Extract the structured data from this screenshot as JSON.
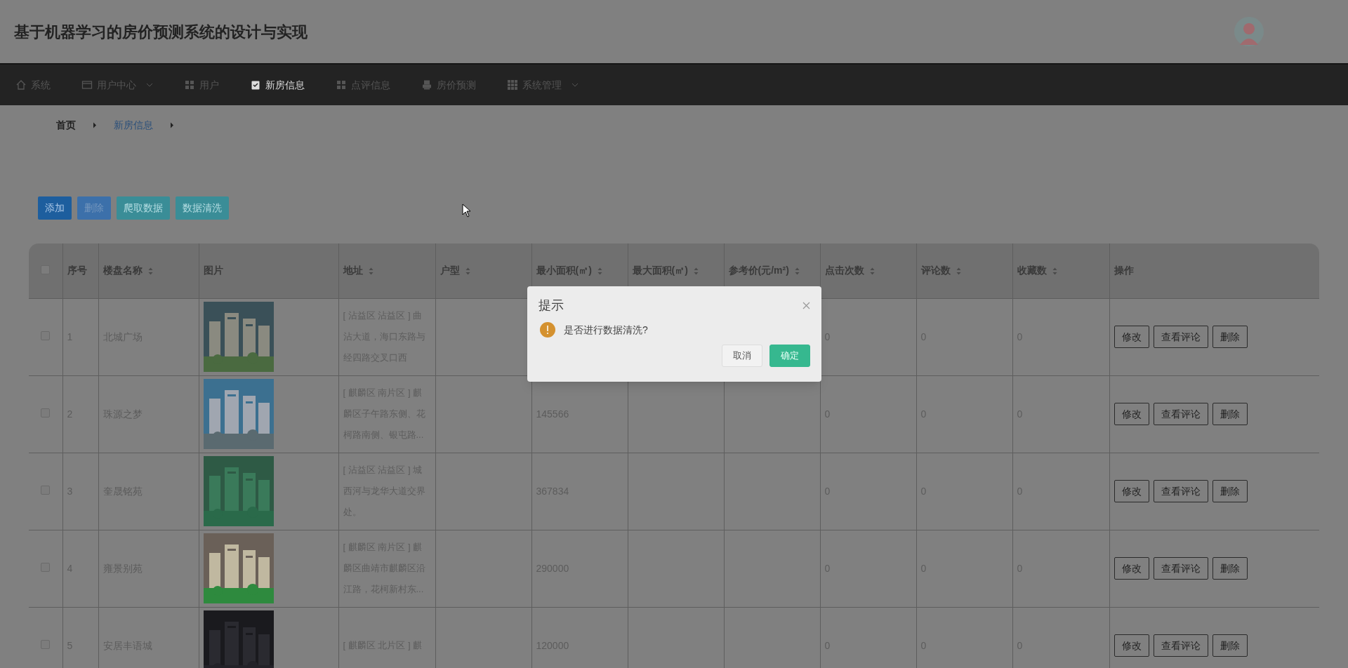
{
  "header": {
    "title": "基于机器学习的房价预测系统的设计与实现"
  },
  "nav": [
    {
      "label": "系统",
      "kind": "house",
      "menu": false,
      "selected": false
    },
    {
      "label": "用户中心",
      "kind": "card",
      "menu": true,
      "selected": false
    },
    {
      "label": "用户",
      "kind": "grid",
      "menu": false,
      "selected": false
    },
    {
      "label": "新房信息",
      "kind": "clipboard",
      "menu": false,
      "selected": true
    },
    {
      "label": "点评信息",
      "kind": "grid",
      "menu": false,
      "selected": false
    },
    {
      "label": "房价预测",
      "kind": "printer",
      "menu": false,
      "selected": false
    },
    {
      "label": "系统管理",
      "kind": "apps",
      "menu": true,
      "selected": false
    }
  ],
  "breadcrumb": [
    {
      "label": "首页",
      "selected": false
    },
    {
      "label": "新房信息",
      "selected": true
    }
  ],
  "toolbar": [
    {
      "label": "添加",
      "kind": "primary"
    },
    {
      "label": "删除",
      "kind": "secondary"
    },
    {
      "label": "爬取数据",
      "kind": "info"
    },
    {
      "label": "数据清洗",
      "kind": "info"
    }
  ],
  "table": {
    "header_checked": false,
    "columns": [
      {
        "label": "序号",
        "sortable": false
      },
      {
        "label": "楼盘名称",
        "sortable": true
      },
      {
        "label": "图片",
        "sortable": false
      },
      {
        "label": "地址",
        "sortable": true
      },
      {
        "label": "户型",
        "sortable": true
      },
      {
        "label": "最小面积(㎡)",
        "sortable": true
      },
      {
        "label": "最大面积(㎡)",
        "sortable": true
      },
      {
        "label": "参考价(元/m²)",
        "sortable": true
      },
      {
        "label": "点击次数",
        "sortable": true
      },
      {
        "label": "评论数",
        "sortable": true
      },
      {
        "label": "收藏数",
        "sortable": true
      },
      {
        "label": "操作",
        "sortable": false
      }
    ],
    "rows": [
      {
        "checked": false,
        "index": "1",
        "name": "北城广场",
        "image": {
          "kind": "picture"
        },
        "address": "[ 沾益区 沾益区 ] 曲沾大道，海口东路与经四路交叉口西",
        "clicks": "0",
        "comments": "0",
        "favorites": "0",
        "actions": [
          "修改",
          "查看评论",
          "删除"
        ]
      },
      {
        "checked": false,
        "index": "2",
        "name": "珠源之梦",
        "image": {
          "kind": "picture"
        },
        "address": "[ 麒麟区 南片区 ] 麒麟区子午路东侧、花柯路南侧、银屯路...",
        "min_area": "145566",
        "clicks": "0",
        "comments": "0",
        "favorites": "0",
        "actions": [
          "修改",
          "查看评论",
          "删除"
        ]
      },
      {
        "checked": false,
        "index": "3",
        "name": "奎晟铭苑",
        "image": {
          "kind": "picture"
        },
        "address": "[ 沾益区 沾益区 ] 城西河与龙华大道交界处。",
        "min_area": "367834",
        "clicks": "0",
        "comments": "0",
        "favorites": "0",
        "actions": [
          "修改",
          "查看评论",
          "删除"
        ]
      },
      {
        "checked": false,
        "index": "4",
        "name": "雍景别苑",
        "image": {
          "kind": "picture"
        },
        "address": "[ 麒麟区 南片区 ] 麒麟区曲靖市麒麟区沿江路，花柯新村东...",
        "min_area": "290000",
        "clicks": "0",
        "comments": "0",
        "favorites": "0",
        "actions": [
          "修改",
          "查看评论",
          "删除"
        ]
      },
      {
        "checked": false,
        "index": "5",
        "name": "安居丰语城",
        "image": {
          "kind": "picture"
        },
        "address": "[ 麒麟区 北片区 ] 麒",
        "min_area": "120000",
        "clicks": "0",
        "comments": "0",
        "favorites": "0",
        "actions": [
          "修改",
          "查看评论",
          "删除"
        ]
      }
    ]
  },
  "dialog": {
    "title": "提示",
    "message": "是否进行数据清洗?",
    "buttons": [
      {
        "label": "取消",
        "kind": "default"
      },
      {
        "label": "确定",
        "kind": "primary"
      }
    ]
  }
}
